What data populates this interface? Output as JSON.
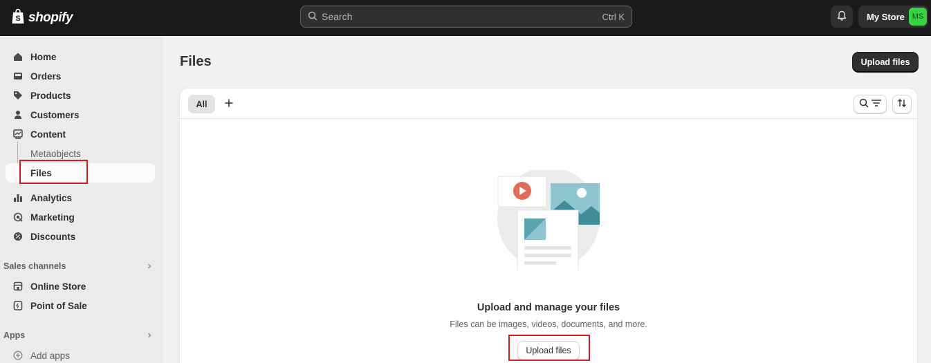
{
  "app": {
    "logo_text": "shopify"
  },
  "search": {
    "placeholder": "Search",
    "shortcut": "Ctrl K"
  },
  "store": {
    "name": "My Store",
    "initials": "MS"
  },
  "sidebar": {
    "items": [
      {
        "label": "Home",
        "icon": "home-icon"
      },
      {
        "label": "Orders",
        "icon": "inbox-icon"
      },
      {
        "label": "Products",
        "icon": "tag-icon"
      },
      {
        "label": "Customers",
        "icon": "person-icon"
      },
      {
        "label": "Content",
        "icon": "content-icon"
      }
    ],
    "content_sub": [
      {
        "label": "Metaobjects"
      },
      {
        "label": "Files",
        "active": true
      }
    ],
    "items2": [
      {
        "label": "Analytics",
        "icon": "bar-chart-icon"
      },
      {
        "label": "Marketing",
        "icon": "target-icon"
      },
      {
        "label": "Discounts",
        "icon": "discount-icon"
      }
    ],
    "sales_channels": {
      "label": "Sales channels",
      "items": [
        {
          "label": "Online Store",
          "icon": "store-icon"
        },
        {
          "label": "Point of Sale",
          "icon": "pos-icon"
        }
      ]
    },
    "apps": {
      "label": "Apps",
      "items": [
        {
          "label": "Add apps",
          "icon": "plus-circle-icon"
        }
      ]
    }
  },
  "main": {
    "title": "Files",
    "upload_button": "Upload files",
    "tabs": [
      {
        "label": "All",
        "selected": true
      }
    ],
    "add_tab": "+",
    "empty_state": {
      "title": "Upload and manage your files",
      "description": "Files can be images, videos, documents, and more.",
      "button": "Upload files"
    }
  },
  "colors": {
    "topbar": "#1a1a1a",
    "sidebar": "#ebebeb",
    "highlight_box": "#cc1f1f",
    "avatar": "#36d344",
    "illustration_teal": "#5ba4b0"
  }
}
